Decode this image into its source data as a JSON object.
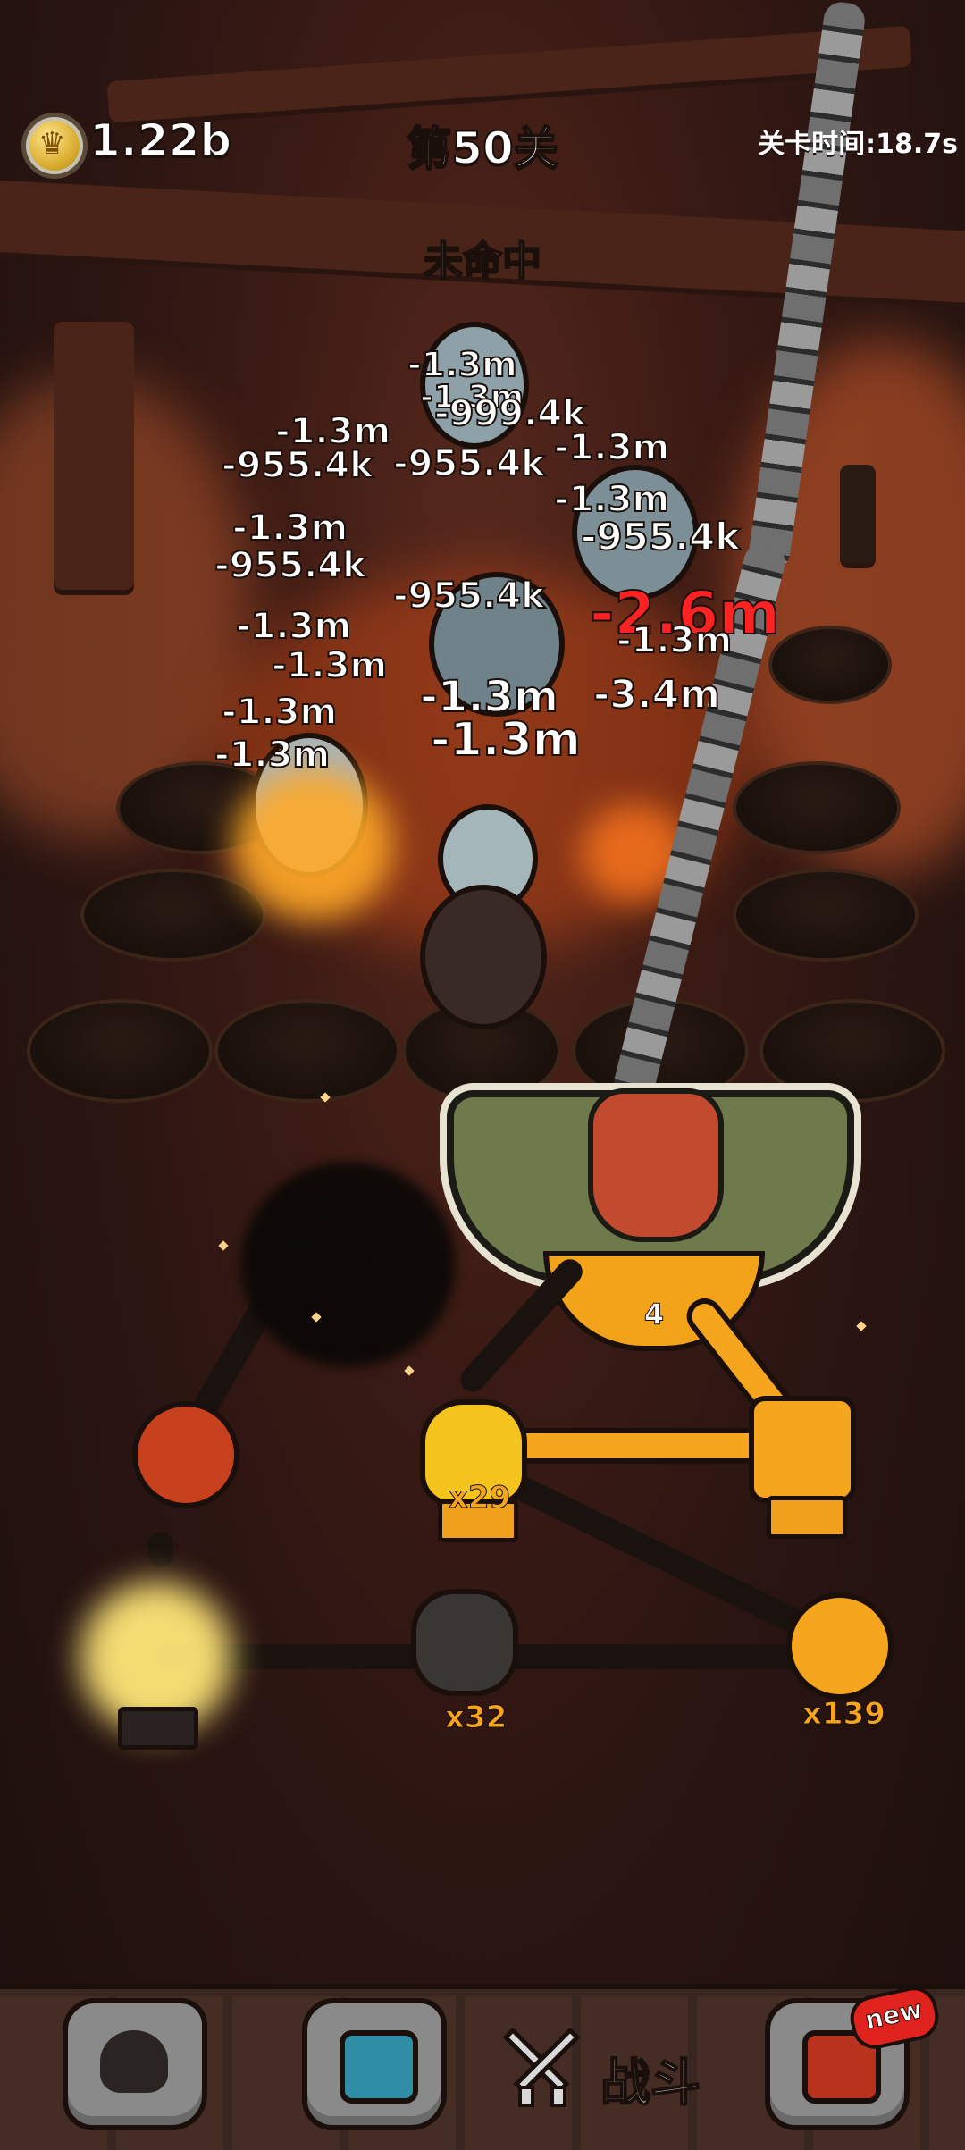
{
  "hud": {
    "coins": "1.22b",
    "level_title": "第50关",
    "level_time": "关卡时间:18.7s",
    "miss_text": "未命中"
  },
  "damage_numbers": [
    "-1.3m",
    "-1.3m",
    "-999.4k",
    "-1.3m",
    "-1.3m",
    "-955.4k",
    "-1.3m",
    "-955.4k",
    "-1.3m",
    "-955.4k",
    "-955.4k",
    "-955.4k",
    "-2.6m",
    "-1.3m",
    "-1.3m",
    "-1.3m",
    "-3.4m",
    "-1.3m",
    "-1.3m",
    "-1.3m",
    "-1.3m"
  ],
  "boss": {
    "level_badge": "4"
  },
  "nodes": {
    "skull_multiplier": "x29",
    "fist_multiplier": "x32",
    "mace_multiplier": "x139"
  },
  "bottom_nav": {
    "fight_label": "战斗",
    "new_badge": "new"
  },
  "colors": {
    "accent_gold": "#f5a51e",
    "damage_red": "#ff2222",
    "background": "#2a1512"
  },
  "icons": {
    "coin": "crown-coin-icon",
    "nav1": "plague-doctor-icon",
    "nav2": "monitor-icon",
    "nav3": "crossed-swords-icon",
    "nav4": "chest-icon"
  }
}
